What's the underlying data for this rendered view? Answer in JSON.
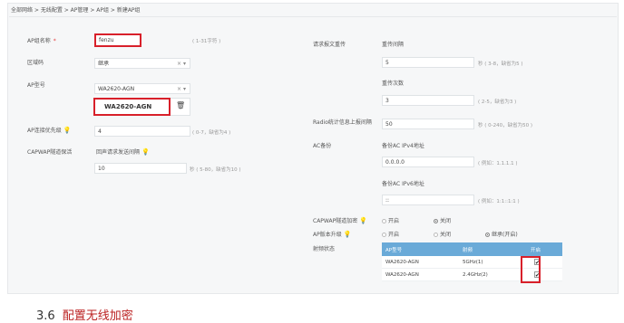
{
  "breadcrumb": "全部网络 > 无线配置 > AP管理 > AP组 > 新建AP组",
  "left": {
    "group_name_label": "AP组名称",
    "required_mark": "*",
    "group_name_value": "fenzu",
    "group_name_hint": "( 1-31字符 )",
    "region_label": "区域码",
    "region_value": "继承",
    "model_label": "AP型号",
    "model_value": "WA2620-AGN",
    "model_added": "WA2620-AGN",
    "priority_label": "AP连接优先级",
    "priority_value": "4",
    "priority_hint": "( 0-7，缺省为4 )",
    "capwap_label": "CAPWAP隧道保活",
    "echo_label": "回声请求发送间隔",
    "echo_value": "10",
    "echo_hint": "秒 ( 5-80，缺省为10 )"
  },
  "right": {
    "retrans_label": "请求报文重传",
    "retrans_interval_label": "重传间隔",
    "retrans_interval_value": "5",
    "retrans_interval_hint": "秒 ( 3-8，缺省为5 )",
    "retrans_count_label": "重传次数",
    "retrans_count_value": "3",
    "retrans_count_hint": "( 2-5，缺省为3 )",
    "radio_label": "Radio统计信息上报间隔",
    "radio_value": "50",
    "radio_hint": "秒 ( 0-240，缺省为50 )",
    "ac_backup_label": "AC备份",
    "ipv4_label": "备份AC IPv4地址",
    "ipv4_value": "0.0.0.0",
    "ipv4_hint": "( 例如：1.1.1.1 )",
    "ipv6_label": "备份AC IPv6地址",
    "ipv6_value": "::",
    "ipv6_hint": "( 例如：1:1::1:1 )",
    "encrypt_label": "CAPWAP隧道加密",
    "encrypt_on": "开启",
    "encrypt_off": "关闭",
    "upgrade_label": "AP版本升级",
    "upgrade_on": "开启",
    "upgrade_off": "关闭",
    "upgrade_inherit": "继承(开启)",
    "radio_state_label": "射频状态",
    "table": {
      "headers": [
        "AP型号",
        "射频",
        "开启"
      ],
      "rows": [
        {
          "model": "WA2620-AGN",
          "radio": "5GHz(1)"
        },
        {
          "model": "WA2620-AGN",
          "radio": "2.4GHz(2)"
        }
      ]
    }
  },
  "footer": {
    "section_num": "3.6",
    "section_text": "配置无线加密"
  }
}
